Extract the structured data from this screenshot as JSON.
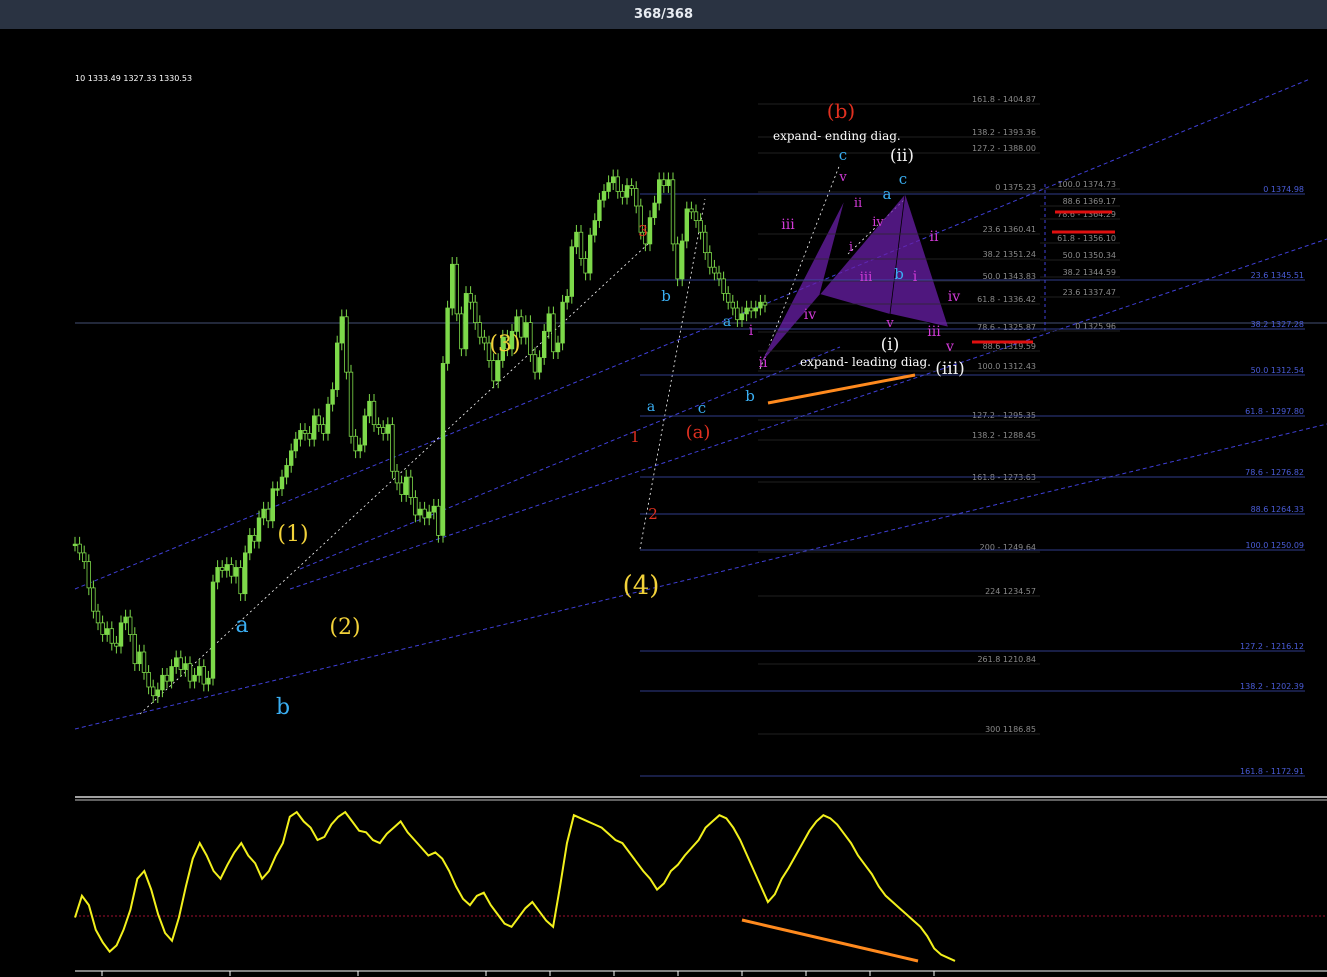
{
  "window": {
    "counter": "368/368"
  },
  "corner_text": "10 1333.49 1327.33 1330.53",
  "colors": {
    "background": "#000000",
    "candles": "#7dd94a",
    "oscillator": "#f2f01c",
    "channel": "#3f3fd6",
    "fib_blue": "#4a5cd8",
    "fib_gray": "#8a8a8a",
    "wave_yellow": "#f2d23a",
    "wave_cyan": "#3aaef2",
    "wave_red": "#e03020",
    "wave_magenta": "#d23ad8",
    "pattern_fill": "#6a1fa8",
    "support_line": "#ff8a1e",
    "target_line": "#e01010"
  },
  "wave_labels": [
    {
      "text": "(1)",
      "color": "yellow"
    },
    {
      "text": "(2)",
      "color": "yellow"
    },
    {
      "text": "(3)",
      "color": "yellow"
    },
    {
      "text": "(4)",
      "color": "yellow"
    },
    {
      "text": "a",
      "color": "cyan"
    },
    {
      "text": "b",
      "color": "cyan"
    },
    {
      "text": "1",
      "color": "red"
    },
    {
      "text": "2",
      "color": "red"
    },
    {
      "text": "3",
      "color": "red"
    },
    {
      "text": "a",
      "color": "cyan"
    },
    {
      "text": "b",
      "color": "cyan"
    },
    {
      "text": "a",
      "color": "cyan"
    },
    {
      "text": "c",
      "color": "cyan"
    },
    {
      "text": "b",
      "color": "cyan"
    },
    {
      "text": "(a)",
      "color": "red"
    },
    {
      "text": "(b)",
      "color": "red"
    },
    {
      "text": "c",
      "color": "cyan"
    },
    {
      "text": "v",
      "color": "magenta"
    },
    {
      "text": "i",
      "color": "magenta"
    },
    {
      "text": "ii",
      "color": "magenta"
    },
    {
      "text": "iii",
      "color": "magenta"
    },
    {
      "text": "iv",
      "color": "magenta"
    },
    {
      "text": "ii",
      "color": "magenta"
    },
    {
      "text": "i",
      "color": "magenta"
    },
    {
      "text": "iii",
      "color": "magenta"
    },
    {
      "text": "iv",
      "color": "magenta"
    },
    {
      "text": "(ii)",
      "color": "white"
    },
    {
      "text": "a",
      "color": "cyan"
    },
    {
      "text": "c",
      "color": "cyan"
    },
    {
      "text": "b",
      "color": "cyan"
    },
    {
      "text": "i",
      "color": "magenta"
    },
    {
      "text": "ii",
      "color": "magenta"
    },
    {
      "text": "iv",
      "color": "magenta"
    },
    {
      "text": "v",
      "color": "magenta"
    },
    {
      "text": "iii",
      "color": "magenta"
    },
    {
      "text": "v",
      "color": "magenta"
    },
    {
      "text": "(i)",
      "color": "white"
    },
    {
      "text": "(iii)",
      "color": "white"
    }
  ],
  "annotations": {
    "ending_diag": "expand- ending diag.",
    "leading_diag": "expand- leading diag."
  },
  "fib_mid": [
    "161.8 - 1404.87",
    "138.2 - 1393.36",
    "127.2 - 1388.00",
    "0 1375.23",
    "23.6 1360.41",
    "38.2 1351.24",
    "50.0 1343.83",
    "61.8 - 1336.42",
    "78.6 - 1325.87",
    "88.6 1319.59",
    "100.0 1312.43",
    "127.2 - 1295.35",
    "138.2 - 1288.45",
    "161.8 - 1273.63",
    "200 - 1249.64",
    "224 1234.57",
    "261.8 1210.84",
    "300 1186.85"
  ],
  "fib_small": [
    "100.0 1374.73",
    "88.6 1369.17",
    "78.6 - 1364.29",
    "61.8 - 1356.10",
    "50.0 1350.34",
    "38.2 1344.59",
    "23.6 1337.47",
    "0 1325.96"
  ],
  "fib_right": [
    "0 1374.98",
    "23.6 1345.51",
    "38.2 1327.28",
    "50.0 1312.54",
    "61.8 - 1297.80",
    "78.6 - 1276.82",
    "88.6 1264.33",
    "100.0 1250.09",
    "127.2 - 1216.12",
    "138.2 - 1202.39",
    "161.8 - 1172.91"
  ],
  "chart_data": {
    "type": "line",
    "title": "",
    "price_series": {
      "name": "",
      "x_index": [
        0,
        5,
        10,
        15,
        20,
        25,
        30,
        35,
        40,
        45,
        50,
        55,
        60,
        65,
        70,
        75,
        80,
        85,
        90,
        95,
        100,
        105,
        110,
        115,
        120,
        125,
        130,
        135,
        140,
        145,
        150,
        155,
        160,
        165,
        170,
        175,
        180,
        185,
        190,
        195,
        200,
        205,
        210,
        215,
        220,
        225,
        230,
        235,
        240,
        245,
        250,
        255,
        260,
        265,
        270,
        275,
        280,
        285,
        290,
        295,
        300,
        305,
        310,
        315,
        320,
        325,
        330,
        335,
        340,
        345,
        350,
        355,
        360,
        365,
        370,
        375,
        380,
        385,
        390,
        395,
        400,
        405,
        410,
        415,
        420,
        425,
        430,
        435,
        440,
        445,
        450,
        455,
        460,
        465,
        470,
        475,
        480,
        485,
        490,
        495,
        500,
        505,
        510,
        515,
        520,
        525,
        530,
        535,
        540,
        545,
        550,
        555,
        560,
        565,
        570,
        575,
        580,
        585,
        590,
        595,
        600,
        605,
        610,
        615,
        620,
        625,
        630,
        635,
        640,
        645,
        650,
        655,
        660,
        665,
        670,
        675,
        680,
        685,
        690,
        695,
        700,
        705,
        710,
        715,
        720,
        725,
        730,
        735,
        740,
        745,
        750,
        755,
        760,
        765,
        770,
        775,
        780,
        785,
        790,
        795,
        800,
        805,
        810,
        815,
        820,
        825,
        830,
        835,
        840,
        845,
        850,
        855,
        860,
        865,
        870,
        875,
        880,
        885,
        890,
        895,
        900,
        905,
        910,
        915,
        920,
        925,
        930,
        935,
        940,
        945,
        950
      ],
      "close": [
        1249,
        1246,
        1243,
        1234,
        1226,
        1222,
        1218,
        1220,
        1215,
        1214,
        1222,
        1224,
        1218,
        1208,
        1212,
        1205,
        1200,
        1197,
        1199,
        1204,
        1202,
        1207,
        1210,
        1206,
        1208,
        1202,
        1204,
        1207,
        1201,
        1203,
        1236,
        1241,
        1240,
        1242,
        1238,
        1241,
        1232,
        1246,
        1252,
        1250,
        1258,
        1261,
        1257,
        1268,
        1268,
        1272,
        1276,
        1281,
        1285,
        1288,
        1287,
        1285,
        1293,
        1290,
        1287,
        1297,
        1302,
        1318,
        1327,
        1308,
        1286,
        1281,
        1283,
        1293,
        1298,
        1290,
        1289,
        1287,
        1290,
        1274,
        1270,
        1266,
        1272,
        1265,
        1259,
        1261,
        1258,
        1260,
        1262,
        1252,
        1311,
        1330,
        1345,
        1328,
        1316,
        1335,
        1332,
        1325,
        1320,
        1318,
        1312,
        1305,
        1312,
        1320,
        1316,
        1322,
        1327,
        1320,
        1325,
        1314,
        1308,
        1313,
        1322,
        1328,
        1315,
        1318,
        1332,
        1334,
        1351,
        1356,
        1347,
        1342,
        1355,
        1360,
        1367,
        1370,
        1373,
        1375,
        1370,
        1368,
        1372,
        1371,
        1365,
        1356,
        1352,
        1361,
        1366,
        1374,
        1372,
        1374,
        1352,
        1340,
        1353,
        1364,
        1363,
        1360,
        1356,
        1349,
        1344,
        1342,
        1340,
        1335,
        1332,
        1330,
        1326,
        1328,
        1330,
        1329,
        1330,
        1332,
        1331
      ],
      "ylim": [
        1165,
        1412
      ]
    },
    "oscillator": {
      "name": "",
      "values": [
        30,
        44,
        38,
        22,
        14,
        8,
        12,
        22,
        35,
        55,
        60,
        48,
        32,
        20,
        15,
        30,
        50,
        68,
        78,
        70,
        60,
        55,
        64,
        72,
        78,
        70,
        65,
        55,
        60,
        70,
        78,
        95,
        98,
        92,
        88,
        80,
        82,
        90,
        95,
        98,
        92,
        86,
        85,
        80,
        78,
        84,
        88,
        92,
        85,
        80,
        75,
        70,
        72,
        68,
        60,
        50,
        42,
        38,
        44,
        46,
        38,
        32,
        26,
        24,
        30,
        36,
        40,
        34,
        28,
        24,
        50,
        78,
        96,
        94,
        92,
        90,
        88,
        84,
        80,
        78,
        72,
        66,
        60,
        55,
        48,
        52,
        60,
        64,
        70,
        75,
        80,
        88,
        92,
        96,
        94,
        88,
        80,
        70,
        60,
        50,
        40,
        45,
        55,
        62,
        70,
        78,
        86,
        92,
        96,
        94,
        90,
        84,
        78,
        70,
        64,
        58,
        50,
        44,
        40,
        36,
        32,
        28,
        24,
        18,
        10,
        6,
        4,
        2
      ],
      "ylim": [
        0,
        100
      ],
      "midline": 30
    }
  }
}
